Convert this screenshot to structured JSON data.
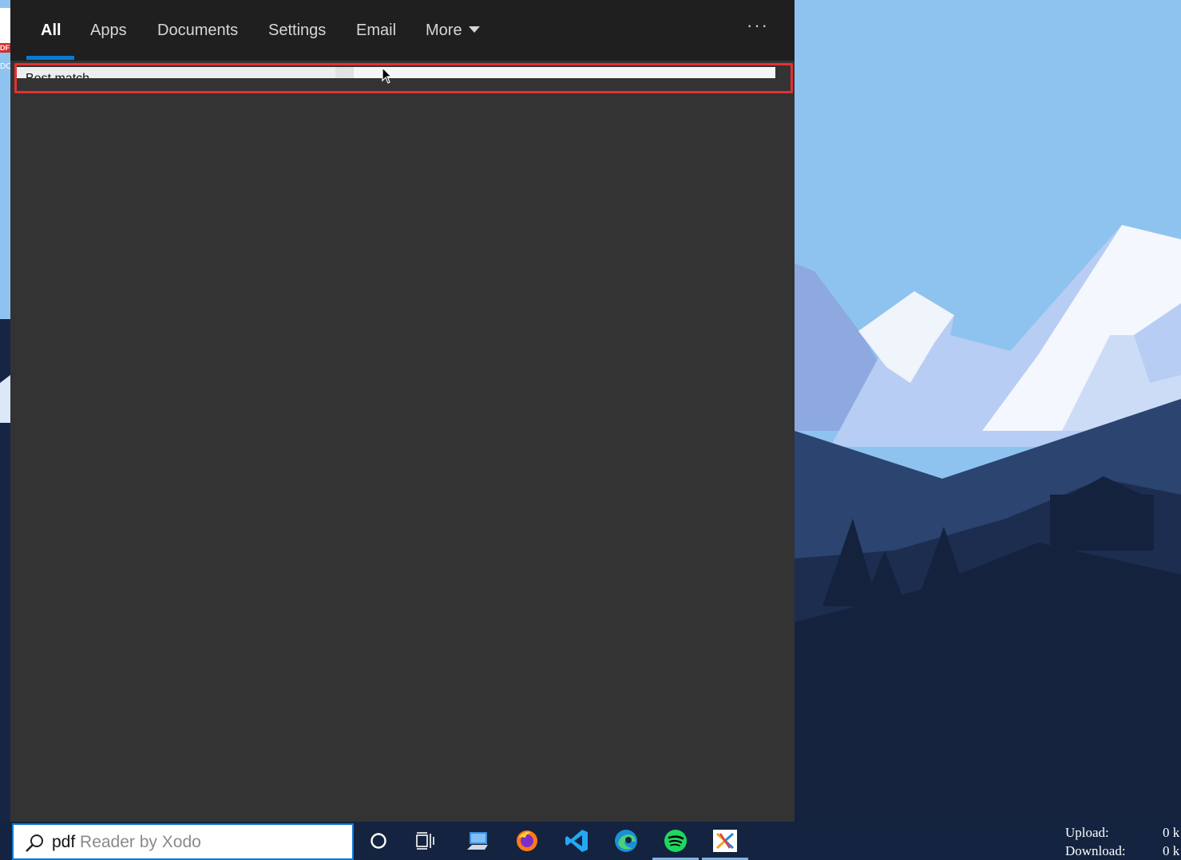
{
  "search_panel": {
    "tabs": [
      {
        "label": "All",
        "active": true
      },
      {
        "label": "Apps",
        "active": false
      },
      {
        "label": "Documents",
        "active": false
      },
      {
        "label": "Settings",
        "active": false
      },
      {
        "label": "Email",
        "active": false
      },
      {
        "label": "More",
        "active": false
      }
    ],
    "more_options_label": "···",
    "result_partial_text": "Best match"
  },
  "taskbar": {
    "search": {
      "typed": "pdf",
      "suggestion": " Reader by Xodo"
    },
    "icons": [
      {
        "name": "cortana-icon"
      },
      {
        "name": "task-view-icon"
      },
      {
        "name": "this-pc-icon"
      },
      {
        "name": "firefox-icon"
      },
      {
        "name": "vscode-icon"
      },
      {
        "name": "edge-icon"
      },
      {
        "name": "spotify-icon"
      },
      {
        "name": "xodo-icon"
      }
    ],
    "network": {
      "upload_label": "Upload:",
      "download_label": "Download:",
      "upload_value": "0 k",
      "download_value": "0 k"
    }
  },
  "desktop": {
    "icon_tag": "DF",
    "icon_label": "DO"
  },
  "colors": {
    "accent": "#0a7bd3",
    "panel_bg": "#333333",
    "tabbar_bg": "#1f1f1f",
    "highlight": "#e63030",
    "taskbar_bg": "#14233f",
    "sky": "#8fc3ef"
  }
}
